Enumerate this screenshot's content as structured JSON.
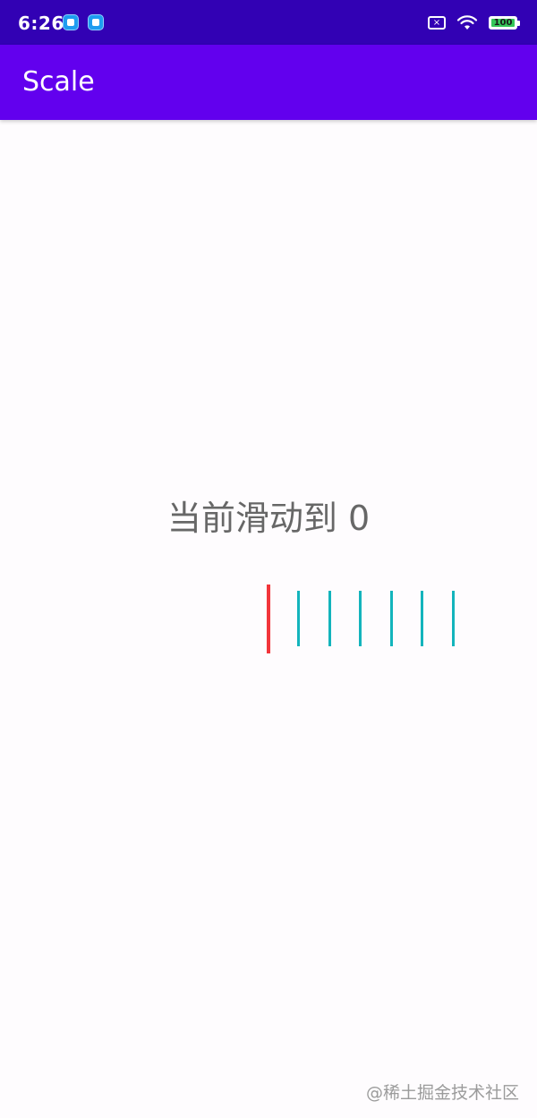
{
  "status_bar": {
    "time": "6:26",
    "battery_level": "100",
    "icons": [
      "notification-app-icon",
      "notification-app-icon",
      "no-sim-icon",
      "wifi-icon",
      "battery-icon"
    ]
  },
  "app_bar": {
    "title": "Scale"
  },
  "main": {
    "current_value_text": "当前滑动到 0"
  },
  "scale": {
    "current_value": 0,
    "indicator_color": "#f2353b",
    "tick_color": "#13b4bc",
    "visible_tick_count": 6
  },
  "watermark": {
    "text": "@稀土掘金技术社区"
  },
  "colors": {
    "status_bar": "#3201b4",
    "app_bar": "#6200ee",
    "background": "#fefcfe",
    "text": "#676767"
  }
}
